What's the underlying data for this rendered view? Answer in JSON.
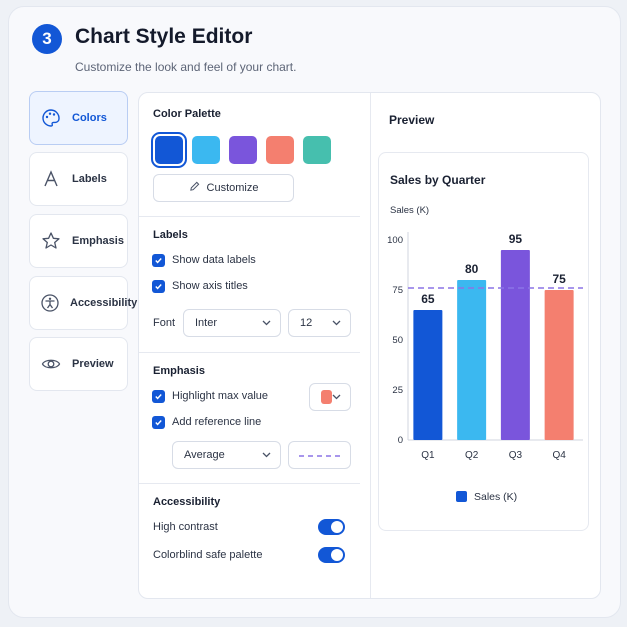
{
  "header": {
    "step": "3",
    "title": "Chart Style Editor",
    "subtitle": "Customize the look and feel of your chart."
  },
  "tabs": [
    {
      "label": "Colors",
      "icon": "palette-icon",
      "active": true
    },
    {
      "label": "Labels",
      "icon": "text-a-icon"
    },
    {
      "label": "Emphasis",
      "icon": "star-icon"
    },
    {
      "label": "Accessibility",
      "icon": "accessibility-icon"
    },
    {
      "label": "Preview",
      "icon": "eye-icon"
    }
  ],
  "color_palette": {
    "title": "Color Palette",
    "swatches": [
      "#1257d6",
      "#3bb8f0",
      "#7a55dc",
      "#f47f6f",
      "#46bfae"
    ],
    "selected": 0,
    "customize_label": "Customize"
  },
  "labels": {
    "title": "Labels",
    "show_data_labels": "Show data labels",
    "show_axis_titles": "Show axis titles",
    "font_label": "Font",
    "font_value": "Inter",
    "size_value": "12"
  },
  "emphasis": {
    "title": "Emphasis",
    "highlight_max": "Highlight max value",
    "highlight_color": "#f47f6f",
    "add_reference": "Add reference line",
    "reference_type": "Average"
  },
  "accessibility": {
    "title": "Accessibility",
    "high_contrast": "High contrast",
    "colorblind": "Colorblind safe palette"
  },
  "preview": {
    "title": "Preview"
  },
  "chart_data": {
    "type": "bar",
    "title": "Sales by Quarter",
    "ylabel": "Sales (K)",
    "xlabel": "",
    "categories": [
      "Q1",
      "Q2",
      "Q3",
      "Q4"
    ],
    "series": [
      {
        "name": "Sales (K)",
        "values": [
          65,
          80,
          95,
          75
        ]
      }
    ],
    "bar_colors": [
      "#1257d6",
      "#3bb8f0",
      "#7a55dc",
      "#f47f6f"
    ],
    "legend_color": "#1257d6",
    "ylim": [
      0,
      100
    ],
    "yticks": [
      0,
      25,
      50,
      75,
      100
    ],
    "reference_line": 76,
    "reference_color": "#8b74e6",
    "grid": false,
    "legend": "bottom"
  }
}
